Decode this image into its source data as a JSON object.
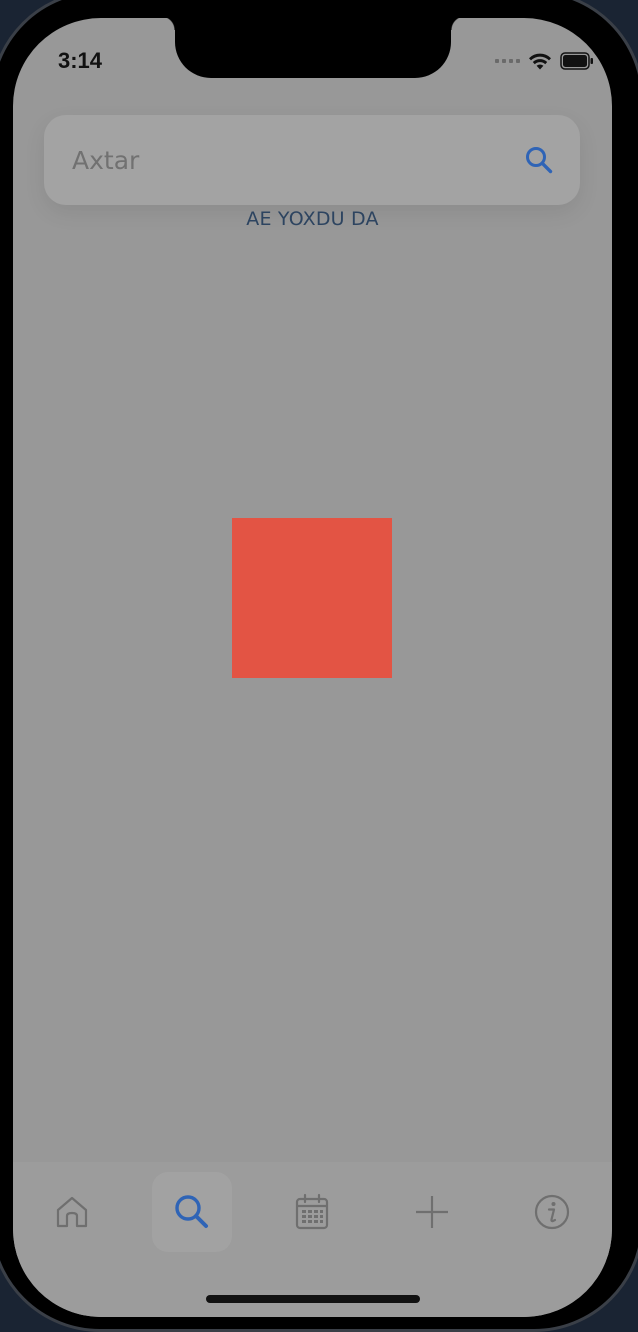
{
  "status_bar": {
    "time": "3:14",
    "icons": [
      "signal-dots-icon",
      "wifi-icon",
      "battery-icon"
    ]
  },
  "search": {
    "placeholder": "Axtar",
    "value": "",
    "icon": "search-icon"
  },
  "message": "AE YOXDU DA",
  "colors": {
    "screen_background": "#989898",
    "accent_blue": "#2f64b6",
    "message_text": "#2d4460",
    "red_block": "#e35444",
    "tab_icon_inactive": "#6f6f6f"
  },
  "tab_bar": {
    "active_index": 1,
    "tabs": [
      {
        "icon": "home-icon"
      },
      {
        "icon": "search-icon"
      },
      {
        "icon": "calendar-icon"
      },
      {
        "icon": "plus-icon"
      },
      {
        "icon": "info-icon"
      }
    ]
  }
}
